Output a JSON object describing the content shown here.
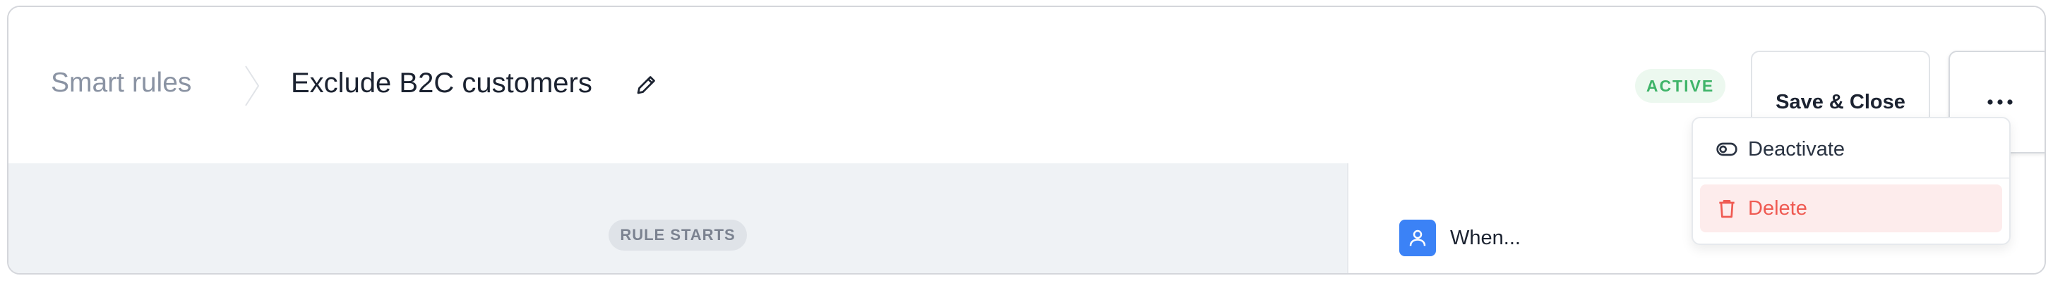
{
  "breadcrumb": {
    "root": "Smart rules",
    "title": "Exclude B2C customers"
  },
  "header": {
    "status": "ACTIVE",
    "save_label": "Save & Close",
    "more_icon": "ellipsis-icon",
    "status_color": "#3fb469"
  },
  "canvas": {
    "rule_starts_label": "RULE STARTS"
  },
  "panel": {
    "when_label": "When...",
    "when_icon": "user-icon",
    "accent": "#3b82f6"
  },
  "menu": {
    "items": [
      {
        "label": "Deactivate",
        "icon": "toggle-icon"
      },
      {
        "label": "Delete",
        "icon": "trash-icon",
        "color": "#ef5a52"
      }
    ]
  }
}
